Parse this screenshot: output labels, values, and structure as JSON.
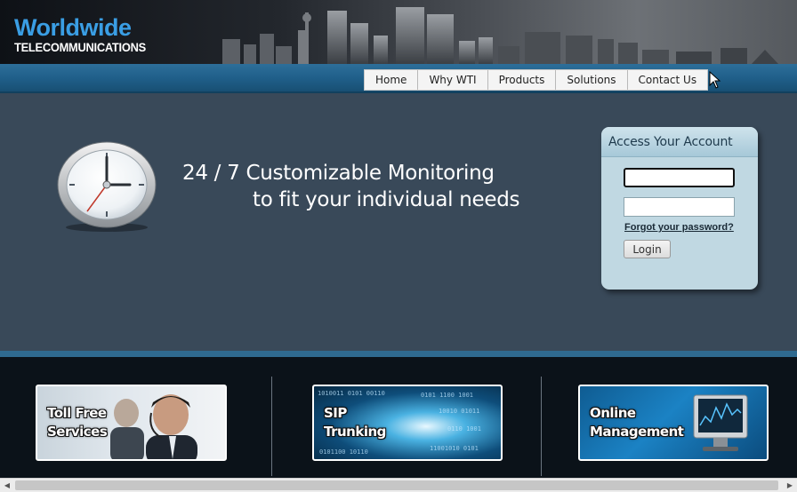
{
  "header": {
    "logo_line1": "Worldwide",
    "logo_line2": "TELECOMMUNICATIONS"
  },
  "nav": {
    "items": [
      {
        "label": "Home"
      },
      {
        "label": "Why WTI"
      },
      {
        "label": "Products"
      },
      {
        "label": "Solutions"
      },
      {
        "label": "Contact Us"
      }
    ]
  },
  "hero": {
    "line1": "24 / 7 Customizable Monitoring",
    "line2": "to fit your individual needs"
  },
  "login": {
    "title": "Access Your Account",
    "username_value": "",
    "password_value": "",
    "forgot_link": "Forgot your password?",
    "button": "Login"
  },
  "tiles": [
    {
      "line1": "Toll Free",
      "line2": "Services"
    },
    {
      "line1": "SIP",
      "line2": "Trunking"
    },
    {
      "line1": "Online",
      "line2": "Management"
    }
  ],
  "colors": {
    "brand_blue": "#3a9ee4",
    "nav_bar": "#1f5e88",
    "main_bg": "#394959",
    "bottom_bg": "#0b1219",
    "login_bg": "#c0d8e2"
  }
}
